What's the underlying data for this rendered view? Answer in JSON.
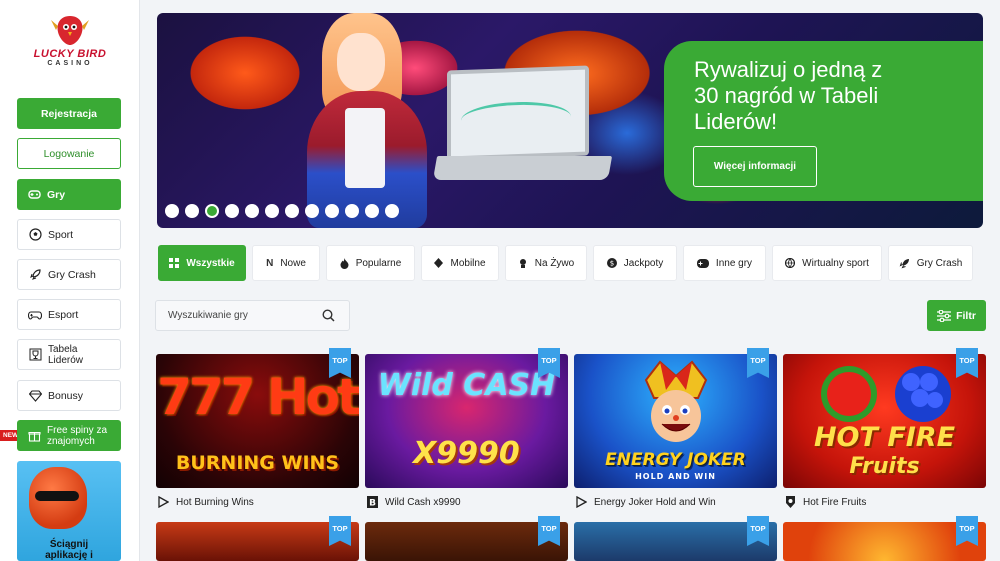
{
  "brand": {
    "line1": "LUCKY BIRD",
    "line2": "CASINO"
  },
  "sidebar": {
    "register": "Rejestracja",
    "login": "Logowanie",
    "items": [
      {
        "label": "Gry",
        "icon": "gamepad-icon",
        "active": true
      },
      {
        "label": "Sport",
        "icon": "soccer-ball-icon"
      },
      {
        "label": "Gry Crash",
        "icon": "rocket-icon"
      },
      {
        "label": "Esport",
        "icon": "controller-icon"
      },
      {
        "label": "Tabela Liderów",
        "icon": "trophy-icon"
      },
      {
        "label": "Bonusy",
        "icon": "diamond-icon"
      },
      {
        "label": "Free spiny za znajomych",
        "icon": "gift-icon"
      }
    ],
    "new_badge": "NEW",
    "promo_text": "Ściągnij aplikację i"
  },
  "hero": {
    "title": "Rywalizuj o jedną z 30 nagród w Tabeli Liderów!",
    "button": "Więcej informacji",
    "slides": 12,
    "active_slide": 3
  },
  "categories": [
    {
      "label": "Wszystkie",
      "icon": "grid-icon",
      "active": true
    },
    {
      "label": "Nowe",
      "icon": "new-icon"
    },
    {
      "label": "Popularne",
      "icon": "flame-icon"
    },
    {
      "label": "Mobilne",
      "icon": "diamond-icon"
    },
    {
      "label": "Na Żywo",
      "icon": "dealer-icon"
    },
    {
      "label": "Jackpoty",
      "icon": "coin-icon"
    },
    {
      "label": "Inne gry",
      "icon": "gamepad-icon"
    },
    {
      "label": "Wirtualny sport",
      "icon": "ball-icon"
    },
    {
      "label": "Gry Crash",
      "icon": "rocket-icon"
    }
  ],
  "search": {
    "placeholder": "Wyszukiwanie gry"
  },
  "filter": {
    "label": "Filtr"
  },
  "badge_top": "TOP",
  "games": [
    {
      "title": "Hot Burning Wins",
      "provider_icon": "play-provider-icon",
      "logo_line1": "777 Hot",
      "logo_line2": "BURNING WINS"
    },
    {
      "title": "Wild Cash x9990",
      "provider_icon": "b-provider-icon",
      "logo_line1": "Wild CASH",
      "logo_line2": "X9990"
    },
    {
      "title": "Energy Joker Hold and Win",
      "provider_icon": "play-provider-icon",
      "logo_line1": "ENERGY JOKER",
      "logo_line2": "HOLD AND WIN"
    },
    {
      "title": "Hot Fire Fruits",
      "provider_icon": "shield-provider-icon",
      "logo_line1": "HOT FIRE",
      "logo_line2": "Fruits"
    }
  ]
}
